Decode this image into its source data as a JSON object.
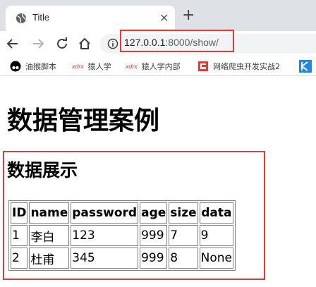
{
  "browser": {
    "tab": {
      "title": "Title",
      "close": "✕"
    },
    "new_tab": "+",
    "address": {
      "host": "127.0.0.1",
      "path": ":8000/show/"
    },
    "bookmarks": [
      {
        "label": "油猴脚本",
        "icon": "tampermonkey-icon"
      },
      {
        "label": "猿人学",
        "icon": "xdrx-logo-icon",
        "logo_text": "xdrx"
      },
      {
        "label": "猿人学内部",
        "icon": "xdrx-logo-icon",
        "logo_text": "xdrx"
      },
      {
        "label": "网络爬虫开发实战2",
        "icon": "crawler-logo-icon"
      }
    ]
  },
  "page": {
    "title": "数据管理案例",
    "section_title": "数据展示",
    "table": {
      "headers": [
        "ID",
        "name",
        "password",
        "age",
        "size",
        "data"
      ],
      "rows": [
        [
          "1",
          "李白",
          "123",
          "999",
          "7",
          "9"
        ],
        [
          "2",
          "杜甫",
          "345",
          "999",
          "8",
          "None"
        ]
      ]
    }
  },
  "colors": {
    "highlight": "#e53935",
    "tabstrip": "#dee1e6",
    "omnibox": "#f1f3f4"
  }
}
